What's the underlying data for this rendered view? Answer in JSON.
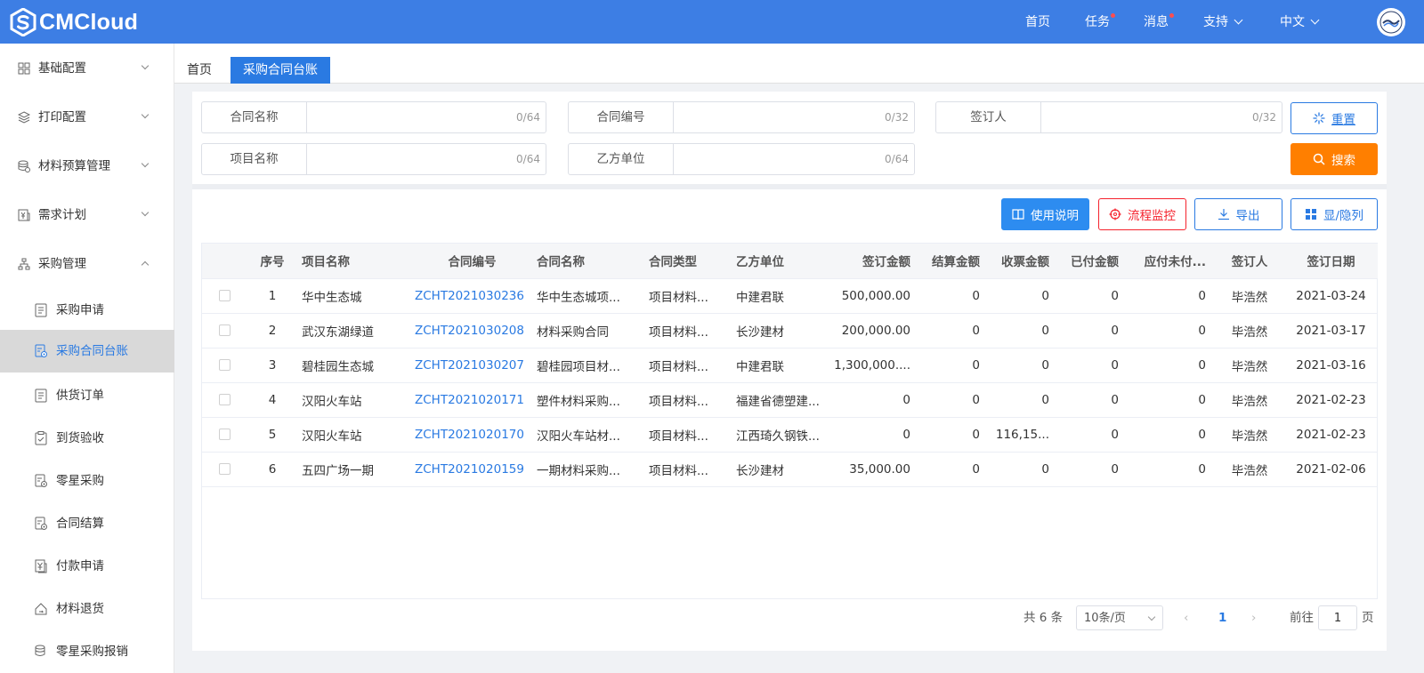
{
  "header": {
    "logo_text": "CMCloud",
    "nav": [
      {
        "label": "首页",
        "has_dot": false
      },
      {
        "label": "任务",
        "has_dot": true
      },
      {
        "label": "消息",
        "has_dot": true
      },
      {
        "label": "支持",
        "has_dot": false,
        "dropdown": true
      },
      {
        "label": "中文",
        "has_dot": false,
        "dropdown": true
      }
    ],
    "accent_color": "#3d7ee4",
    "dot_color": "#ff4d4f"
  },
  "sidebar": {
    "menus": [
      {
        "label": "基础配置",
        "icon": "grid-icon",
        "expanded": false
      },
      {
        "label": "打印配置",
        "icon": "layers-icon",
        "expanded": false
      },
      {
        "label": "材料预算管理",
        "icon": "database-icon",
        "expanded": false
      },
      {
        "label": "需求计划",
        "icon": "yuan-doc-icon",
        "expanded": false
      },
      {
        "label": "采购管理",
        "icon": "org-icon",
        "expanded": true
      }
    ],
    "sub_items": [
      {
        "label": "采购申请",
        "icon": "list-doc-icon",
        "active": false
      },
      {
        "label": "采购合同台账",
        "icon": "doc-settings-icon",
        "active": true
      },
      {
        "label": "供货订单",
        "icon": "list-doc-icon",
        "active": false
      },
      {
        "label": "到货验收",
        "icon": "clipboard-check-icon",
        "active": false
      },
      {
        "label": "零星采购",
        "icon": "doc-settings-icon",
        "active": false
      },
      {
        "label": "合同结算",
        "icon": "doc-settings-icon",
        "active": false
      },
      {
        "label": "付款申请",
        "icon": "yuan-doc-icon",
        "active": false
      },
      {
        "label": "材料退货",
        "icon": "house-return-icon",
        "active": false
      },
      {
        "label": "零星采购报销",
        "icon": "database-icon",
        "active": false
      }
    ]
  },
  "tabs": {
    "home": "首页",
    "active": "采购合同台账"
  },
  "filters": {
    "contract_name": {
      "label": "合同名称",
      "value": "",
      "count": "0/64"
    },
    "contract_no": {
      "label": "合同编号",
      "value": "",
      "count": "0/32"
    },
    "signer": {
      "label": "签订人",
      "value": "",
      "count": "0/32"
    },
    "project_name": {
      "label": "项目名称",
      "value": "",
      "count": "0/64"
    },
    "party_b": {
      "label": "乙方单位",
      "value": "",
      "count": "0/64"
    },
    "reset_label": "重置",
    "search_label": "搜索"
  },
  "toolbar": {
    "help_label": "使用说明",
    "monitor_label": "流程监控",
    "export_label": "导出",
    "columns_label": "显/隐列"
  },
  "table": {
    "columns": [
      "序号",
      "项目名称",
      "合同编号",
      "合同名称",
      "合同类型",
      "乙方单位",
      "签订金额",
      "结算金额",
      "收票金额",
      "已付金额",
      "应付未付...",
      "签订人",
      "签订日期"
    ],
    "rows": [
      {
        "no": "1",
        "project": "华中生态城",
        "contract_no": "ZCHT2021030236",
        "contract_name": "华中生态城项...",
        "type": "项目材料...",
        "party_b": "中建君联",
        "sign_amt": "500,000.00",
        "settle_amt": "0",
        "invoice_amt": "0",
        "paid_amt": "0",
        "unpaid": "0",
        "signer": "毕浩然",
        "date": "2021-03-24"
      },
      {
        "no": "2",
        "project": "武汉东湖绿道",
        "contract_no": "ZCHT2021030208",
        "contract_name": "材料采购合同",
        "type": "项目材料...",
        "party_b": "长沙建材",
        "sign_amt": "200,000.00",
        "settle_amt": "0",
        "invoice_amt": "0",
        "paid_amt": "0",
        "unpaid": "0",
        "signer": "毕浩然",
        "date": "2021-03-17"
      },
      {
        "no": "3",
        "project": "碧桂园生态城",
        "contract_no": "ZCHT2021030207",
        "contract_name": "碧桂园项目材...",
        "type": "项目材料...",
        "party_b": "中建君联",
        "sign_amt": "1,300,000....",
        "settle_amt": "0",
        "invoice_amt": "0",
        "paid_amt": "0",
        "unpaid": "0",
        "signer": "毕浩然",
        "date": "2021-03-16"
      },
      {
        "no": "4",
        "project": "汉阳火车站",
        "contract_no": "ZCHT2021020171",
        "contract_name": "塑件材料采购...",
        "type": "项目材料...",
        "party_b": "福建省德塑建...",
        "sign_amt": "0",
        "settle_amt": "0",
        "invoice_amt": "0",
        "paid_amt": "0",
        "unpaid": "0",
        "signer": "毕浩然",
        "date": "2021-02-23"
      },
      {
        "no": "5",
        "project": "汉阳火车站",
        "contract_no": "ZCHT2021020170",
        "contract_name": "汉阳火车站材...",
        "type": "项目材料...",
        "party_b": "江西琦久钢铁...",
        "sign_amt": "0",
        "settle_amt": "0",
        "invoice_amt": "116,15...",
        "paid_amt": "0",
        "unpaid": "0",
        "signer": "毕浩然",
        "date": "2021-02-23"
      },
      {
        "no": "6",
        "project": "五四广场一期",
        "contract_no": "ZCHT2021020159",
        "contract_name": "一期材料采购...",
        "type": "项目材料...",
        "party_b": "长沙建材",
        "sign_amt": "35,000.00",
        "settle_amt": "0",
        "invoice_amt": "0",
        "paid_amt": "0",
        "unpaid": "0",
        "signer": "毕浩然",
        "date": "2021-02-06"
      }
    ]
  },
  "pagination": {
    "total": "共 6 条",
    "page_size": "10条/页",
    "current_page": "1",
    "goto_label": "前往",
    "goto_value": "1",
    "page_suffix": "页"
  }
}
